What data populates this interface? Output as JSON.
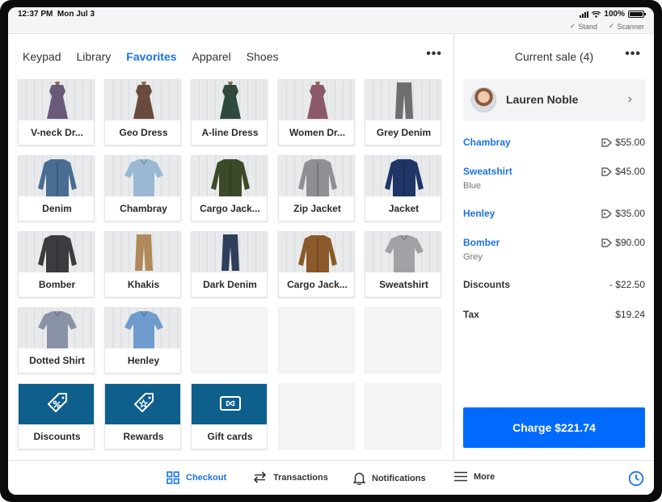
{
  "status": {
    "time": "12:37 PM",
    "date": "Mon Jul 3",
    "battery": "100%",
    "stand": "Stand",
    "scanner": "Scanner"
  },
  "tabs": [
    {
      "label": "Keypad"
    },
    {
      "label": "Library"
    },
    {
      "label": "Favorites",
      "active": true
    },
    {
      "label": "Apparel"
    },
    {
      "label": "Shoes"
    }
  ],
  "more_glyph": "•••",
  "items": [
    {
      "label": "V-neck Dr...",
      "color": "#6a5a7a"
    },
    {
      "label": "Geo Dress",
      "color": "#6b4a3e"
    },
    {
      "label": "A-line Dress",
      "color": "#2f4a3c"
    },
    {
      "label": "Women Dr...",
      "color": "#8a5a6a"
    },
    {
      "label": "Grey Denim",
      "color": "#6e6e70"
    },
    {
      "label": "Denim",
      "color": "#4a6d92"
    },
    {
      "label": "Chambray",
      "color": "#9ab8d3"
    },
    {
      "label": "Cargo Jack...",
      "color": "#3d4a2a"
    },
    {
      "label": "Zip Jacket",
      "color": "#8e8f94"
    },
    {
      "label": "Jacket",
      "color": "#1f3666"
    },
    {
      "label": "Bomber",
      "color": "#3c3c40"
    },
    {
      "label": "Khakis",
      "color": "#b08a5a"
    },
    {
      "label": "Dark Denim",
      "color": "#2f3e5a"
    },
    {
      "label": "Cargo Jack...",
      "color": "#8a5a2a"
    },
    {
      "label": "Sweatshirt",
      "color": "#a0a2a6"
    },
    {
      "label": "Dotted Shirt",
      "color": "#8a93a6"
    },
    {
      "label": "Henley",
      "color": "#6e9ccc"
    }
  ],
  "actions": [
    {
      "label": "Discounts",
      "icon": "discount-tag-icon"
    },
    {
      "label": "Rewards",
      "icon": "reward-tag-icon"
    },
    {
      "label": "Gift cards",
      "icon": "gift-card-icon"
    }
  ],
  "sale": {
    "title": "Current sale (4)",
    "customer": "Lauren Noble",
    "lines": [
      {
        "name": "Chambray",
        "price": "$55.00"
      },
      {
        "name": "Sweatshirt",
        "sub": "Blue",
        "price": "$45.00"
      },
      {
        "name": "Henley",
        "price": "$35.00"
      },
      {
        "name": "Bomber",
        "sub": "Grey",
        "price": "$90.00"
      }
    ],
    "discounts_label": "Discounts",
    "discounts_value": "- $22.50",
    "tax_label": "Tax",
    "tax_value": "$19.24",
    "charge_label": "Charge $221.74"
  },
  "nav": {
    "checkout": "Checkout",
    "transactions": "Transactions",
    "notifications": "Notifications",
    "more": "More"
  },
  "colors": {
    "accent": "#1a73e8",
    "charge": "#006aff",
    "action_tile": "#0f5f8c"
  }
}
